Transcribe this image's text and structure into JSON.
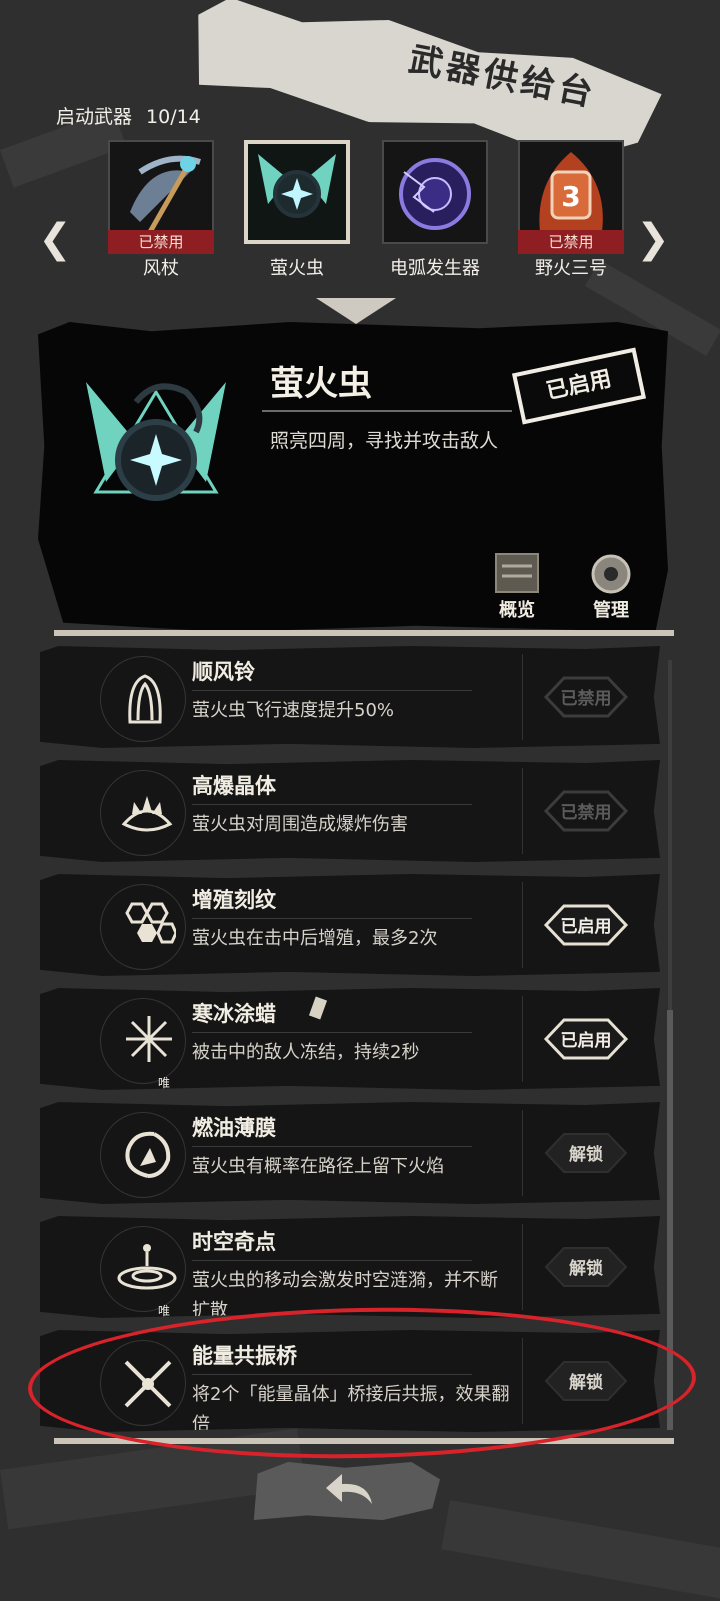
{
  "header": {
    "banner_title": "武器供给台",
    "launch_label": "启动武器",
    "launch_count": "10/14"
  },
  "weapons": [
    {
      "name": "风杖",
      "badge": "已禁用"
    },
    {
      "name": "萤火虫",
      "badge": ""
    },
    {
      "name": "电弧发生器",
      "badge": ""
    },
    {
      "name": "野火三号",
      "badge": "已禁用"
    }
  ],
  "detail": {
    "title": "萤火虫",
    "description": "照亮四周，寻找并攻击敌人",
    "status": "已启用",
    "overview_label": "概览",
    "manage_label": "管理"
  },
  "upgrades": [
    {
      "name": "顺风铃",
      "desc": "萤火虫飞行速度提升50%",
      "action": "已禁用",
      "state": "disabled",
      "unique": ""
    },
    {
      "name": "高爆晶体",
      "desc": "萤火虫对周围造成爆炸伤害",
      "action": "已禁用",
      "state": "disabled",
      "unique": ""
    },
    {
      "name": "增殖刻纹",
      "desc": "萤火虫在击中后增殖，最多2次",
      "action": "已启用",
      "state": "enabled",
      "unique": ""
    },
    {
      "name": "寒冰涂蜡",
      "desc": "被击中的敌人冻结，持续2秒",
      "action": "已启用",
      "state": "enabled",
      "unique": "唯一"
    },
    {
      "name": "燃油薄膜",
      "desc": "萤火虫有概率在路径上留下火焰",
      "action": "解锁",
      "state": "unlock",
      "unique": ""
    },
    {
      "name": "时空奇点",
      "desc": "萤火虫的移动会激发时空涟漪，并不断扩散",
      "action": "解锁",
      "state": "unlock",
      "unique": "唯一"
    },
    {
      "name": "能量共振桥",
      "desc": "将2个「能量晶体」桥接后共振，效果翻倍",
      "action": "解锁",
      "state": "unlock",
      "unique": ""
    }
  ],
  "colors": {
    "ban_red": "#8e1e22",
    "highlight_circle": "#d8232a",
    "teal": "#6fd3c0"
  }
}
